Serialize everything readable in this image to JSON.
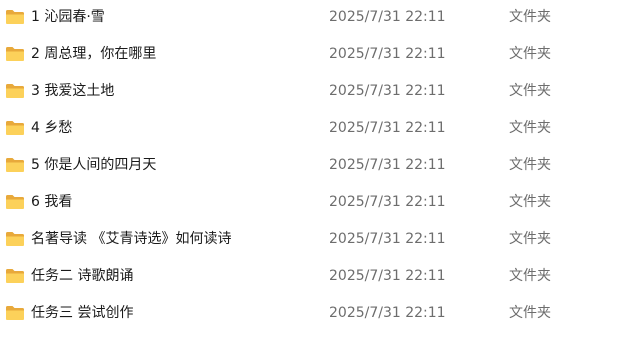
{
  "file_list": {
    "rows": [
      {
        "name": "1 沁园春·雪",
        "modified": "2025/7/31 22:11",
        "type": "文件夹",
        "icon": "folder-icon"
      },
      {
        "name": "2 周总理，你在哪里",
        "modified": "2025/7/31 22:11",
        "type": "文件夹",
        "icon": "folder-icon"
      },
      {
        "name": "3 我爱这土地",
        "modified": "2025/7/31 22:11",
        "type": "文件夹",
        "icon": "folder-icon"
      },
      {
        "name": "4 乡愁",
        "modified": "2025/7/31 22:11",
        "type": "文件夹",
        "icon": "folder-icon"
      },
      {
        "name": "5 你是人间的四月天",
        "modified": "2025/7/31 22:11",
        "type": "文件夹",
        "icon": "folder-icon"
      },
      {
        "name": "6 我看",
        "modified": "2025/7/31 22:11",
        "type": "文件夹",
        "icon": "folder-icon"
      },
      {
        "name": "名著导读 《艾青诗选》如何读诗",
        "modified": "2025/7/31 22:11",
        "type": "文件夹",
        "icon": "folder-icon"
      },
      {
        "name": "任务二 诗歌朗诵",
        "modified": "2025/7/31 22:11",
        "type": "文件夹",
        "icon": "folder-icon"
      },
      {
        "name": "任务三 尝试创作",
        "modified": "2025/7/31 22:11",
        "type": "文件夹",
        "icon": "folder-icon"
      }
    ]
  },
  "colors": {
    "folder_back": "#e8a93b",
    "folder_front": "#fcd15a",
    "name_text": "#1a1a1a",
    "meta_text": "#6d6d6d"
  }
}
